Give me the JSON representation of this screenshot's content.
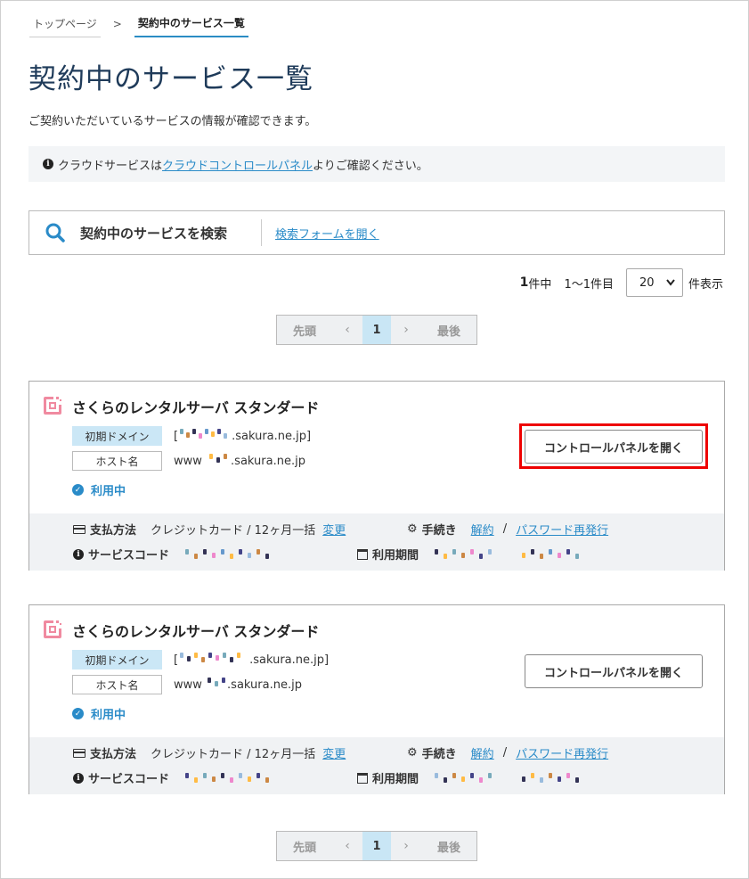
{
  "breadcrumb": {
    "home": "トップページ",
    "separator": ">",
    "current": "契約中のサービス一覧"
  },
  "page": {
    "title": "契約中のサービス一覧",
    "description": "ご契約いただいているサービスの情報が確認できます。"
  },
  "notice": {
    "icon": "info-icon",
    "before": "クラウドサービスは",
    "link": "クラウドコントロールパネル",
    "after": "よりご確認ください。"
  },
  "search": {
    "title": "契約中のサービスを検索",
    "open_link": "検索フォームを開く"
  },
  "results": {
    "count": "1",
    "count_suffix": "件中",
    "range": "1〜1件目",
    "per_page": "20",
    "per_page_label": "件表示"
  },
  "pager": {
    "first": "先頭",
    "prev": "‹",
    "current": "1",
    "next": "›",
    "last": "最後"
  },
  "colors": {
    "accent": "#2a8bc8",
    "highlight": "#e00000",
    "title": "#1f3b5a"
  },
  "services": [
    {
      "title": "さくらのレンタルサーバ スタンダード",
      "domain_label": "初期ドメイン",
      "domain_value": ".sakura.ne.jp]",
      "domain_prefix": "[",
      "host_label": "ホスト名",
      "host_prefix": "www",
      "host_value": ".sakura.ne.jp",
      "status": "利用中",
      "button": "コントロールパネルを開く",
      "highlighted": true,
      "payment_label": "支払方法",
      "payment_value": "クレジットカード / 12ヶ月一括",
      "payment_change": "変更",
      "procedure_label": "手続き",
      "cancel": "解約",
      "separator": "/",
      "password": "パスワード再発行",
      "code_label": "サービスコード",
      "period_label": "利用期間"
    },
    {
      "title": "さくらのレンタルサーバ スタンダード",
      "domain_label": "初期ドメイン",
      "domain_value": ".sakura.ne.jp]",
      "domain_prefix": "[",
      "host_label": "ホスト名",
      "host_prefix": "www",
      "host_value": ".sakura.ne.jp",
      "status": "利用中",
      "button": "コントロールパネルを開く",
      "highlighted": false,
      "payment_label": "支払方法",
      "payment_value": "クレジットカード / 12ヶ月一括",
      "payment_change": "変更",
      "procedure_label": "手続き",
      "cancel": "解約",
      "separator": "/",
      "password": "パスワード再発行",
      "code_label": "サービスコード",
      "period_label": "利用期間"
    }
  ]
}
